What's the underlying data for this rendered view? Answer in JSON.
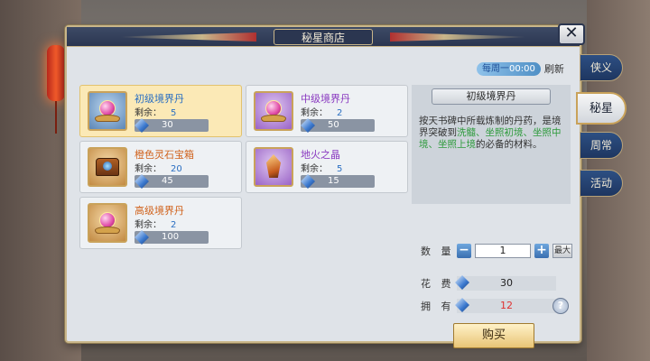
{
  "window": {
    "title": "秘星商店"
  },
  "refresh": {
    "time_prefix": "每周一",
    "time": "00:00",
    "label": "刷新"
  },
  "items": [
    {
      "name": "初级境界丹",
      "remain_label": "剩余：",
      "remain": "5",
      "price": "30"
    },
    {
      "name": "中级境界丹",
      "remain_label": "剩余：",
      "remain": "2",
      "price": "50"
    },
    {
      "name": "橙色灵石宝箱",
      "remain_label": "剩余：",
      "remain": "20",
      "price": "45"
    },
    {
      "name": "地火之晶",
      "remain_label": "剩余：",
      "remain": "5",
      "price": "15"
    },
    {
      "name": "高级境界丹",
      "remain_label": "剩余：",
      "remain": "2",
      "price": "100"
    }
  ],
  "detail": {
    "title": "初级境界丹",
    "desc_1": "按天书碑中所载炼制的丹药，是境界突破到",
    "desc_g1": "洗髓、坐照初境、坐照中境、坐照上境",
    "desc_2": "的必备的材料。",
    "qty_label": "数 量",
    "qty_value": "1",
    "qty_minus": "−",
    "qty_plus": "+",
    "max_label": "最大",
    "cost_label": "花 费",
    "cost_value": "30",
    "own_label": "拥 有",
    "own_value": "12",
    "help": "?",
    "buy_label": "购买"
  },
  "tabs": [
    {
      "label": "侠义"
    },
    {
      "label": "秘星"
    },
    {
      "label": "周常"
    },
    {
      "label": "活动"
    }
  ],
  "close_label": "✕"
}
